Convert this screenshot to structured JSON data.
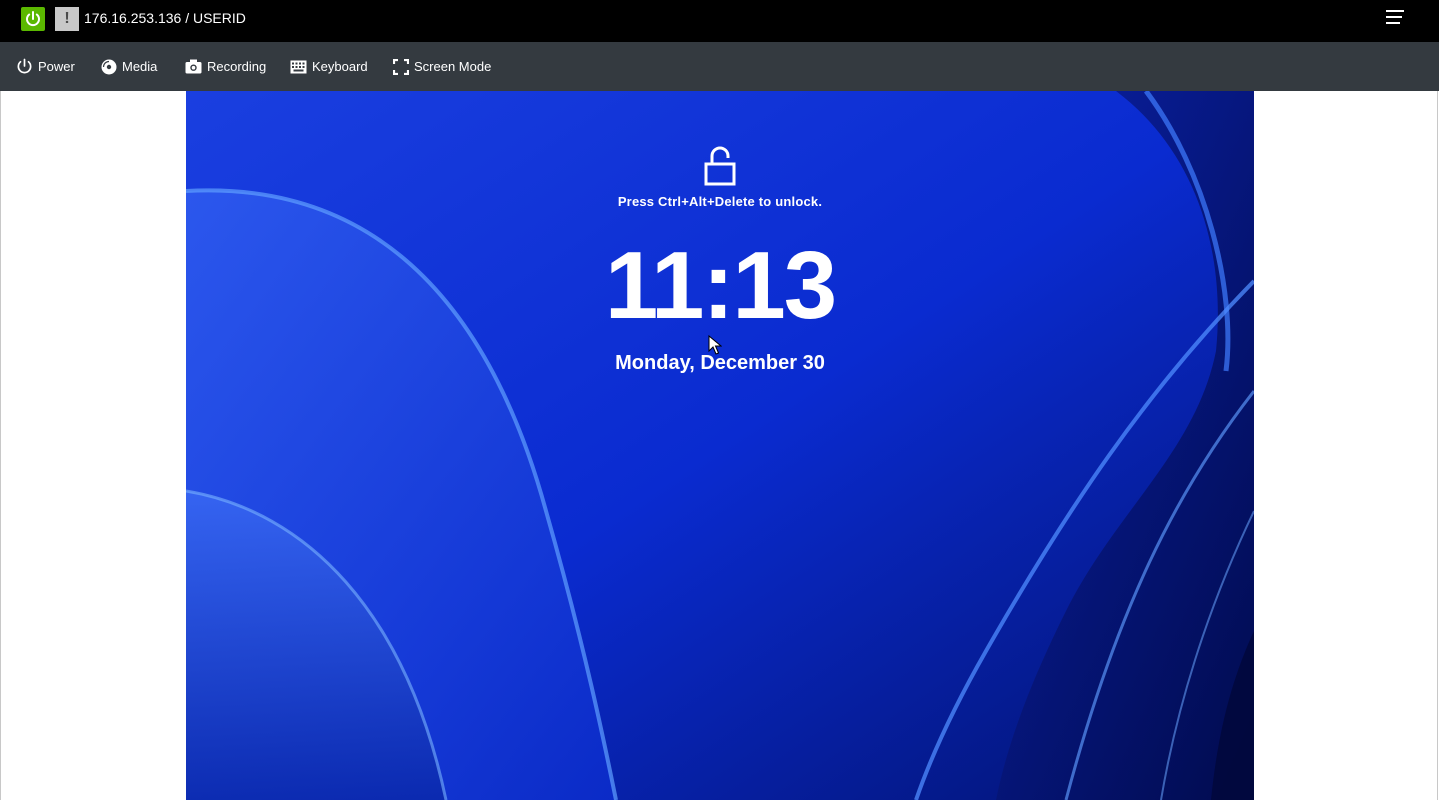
{
  "app": {
    "host_label": "176.16.253.136 / USERID",
    "alert_glyph": "!",
    "power_status_color": "#5bb800"
  },
  "toolbar": {
    "items": [
      {
        "label": "Power",
        "icon": "power-icon"
      },
      {
        "label": "Media",
        "icon": "disc-icon"
      },
      {
        "label": "Recording",
        "icon": "camera-icon"
      },
      {
        "label": "Keyboard",
        "icon": "keyboard-icon"
      },
      {
        "label": "Screen Mode",
        "icon": "fullscreen-icon"
      }
    ]
  },
  "remote": {
    "lock_hint": "Press Ctrl+Alt+Delete to unlock.",
    "time": "11:13",
    "date": "Monday, December 30",
    "accent_color": "#0b2fd6"
  }
}
